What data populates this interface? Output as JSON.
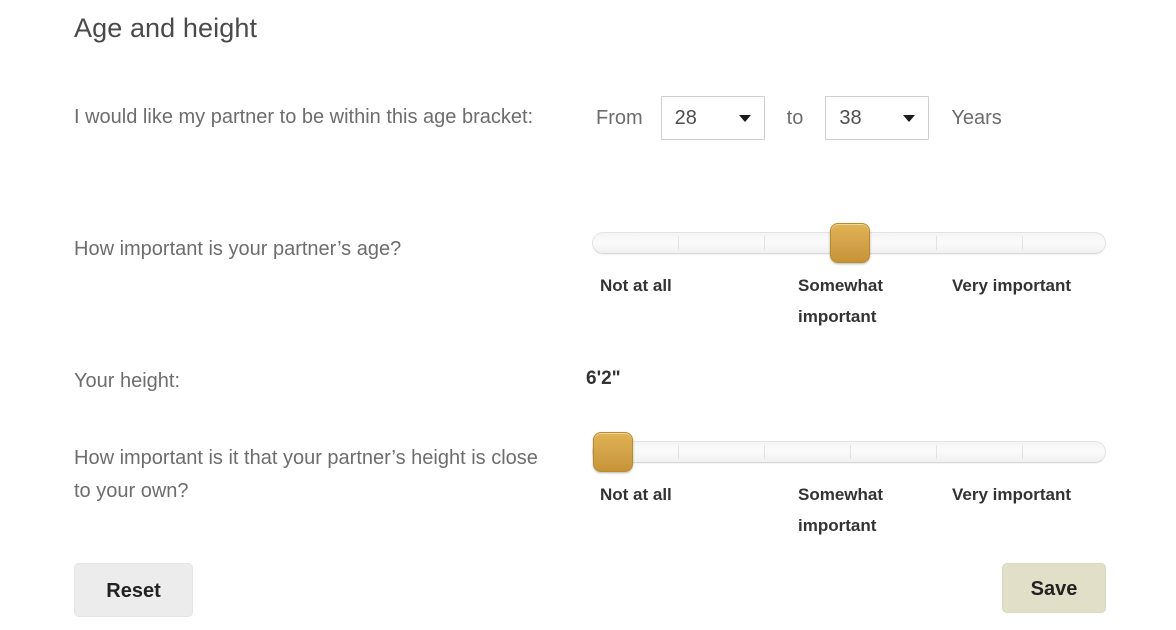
{
  "page": {
    "title": "Age and height"
  },
  "age_bracket": {
    "question": "I would like my partner to be within this age bracket:",
    "from_label": "From",
    "to_label": "to",
    "units_label": "Years",
    "from_value": "28",
    "to_value": "38"
  },
  "age_importance": {
    "question": "How important is your partner’s age?",
    "scale": {
      "low": "Not at all",
      "mid": "Somewhat important",
      "high": "Very important"
    },
    "value_percent": 50
  },
  "height": {
    "label": "Your height:",
    "value": "6'2\""
  },
  "height_importance": {
    "question": "How important is it that your partner’s height is close to your own?",
    "scale": {
      "low": "Not at all",
      "mid": "Somewhat important",
      "high": "Very important"
    },
    "value_percent": 0
  },
  "actions": {
    "reset_label": "Reset",
    "save_label": "Save"
  },
  "colors": {
    "handle": "#d3a349",
    "save_bg": "#e2dfc9",
    "reset_bg": "#ececec",
    "text": "#6d6d6d"
  }
}
